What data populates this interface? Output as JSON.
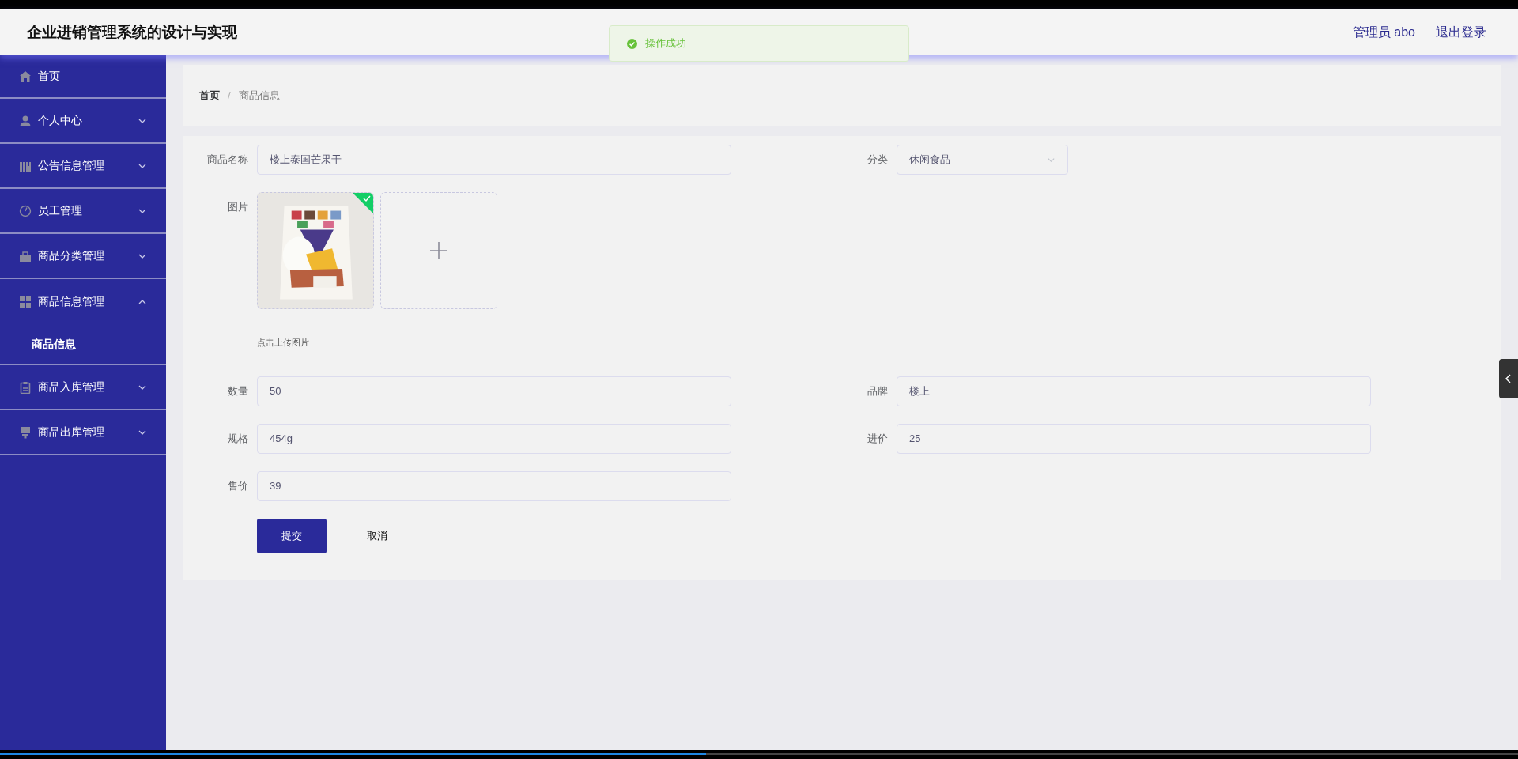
{
  "header": {
    "title": "企业进销管理系统的设计与实现",
    "user": "管理员 abo",
    "logout": "退出登录"
  },
  "toast": {
    "kind": "success",
    "message": "操作成功"
  },
  "sidebar": {
    "items": [
      {
        "label": "首页",
        "kind": "link"
      },
      {
        "label": "个人中心",
        "kind": "menu",
        "expanded": false
      },
      {
        "label": "公告信息管理",
        "kind": "menu",
        "expanded": false
      },
      {
        "label": "员工管理",
        "kind": "menu",
        "expanded": false
      },
      {
        "label": "商品分类管理",
        "kind": "menu",
        "expanded": false
      },
      {
        "label": "商品信息管理",
        "kind": "menu",
        "expanded": true,
        "children": [
          {
            "label": "商品信息"
          }
        ]
      },
      {
        "label": "商品入库管理",
        "kind": "menu",
        "expanded": false
      },
      {
        "label": "商品出库管理",
        "kind": "menu",
        "expanded": false
      }
    ]
  },
  "breadcrumb": {
    "separator": "/",
    "items": [
      "首页",
      "商品信息"
    ]
  },
  "form": {
    "rows": [
      [
        {
          "label": "商品名称",
          "kind": "text",
          "value": "楼上泰国芒果干"
        },
        {
          "label": "分类",
          "kind": "select",
          "value": "休闲食品"
        }
      ],
      [
        {
          "label": "图片",
          "kind": "upload",
          "uploaded": true,
          "hint": "点击上传图片"
        }
      ],
      [
        {
          "label": "数量",
          "kind": "text",
          "value": "50"
        },
        {
          "label": "品牌",
          "kind": "text",
          "value": "楼上"
        }
      ],
      [
        {
          "label": "规格",
          "kind": "text",
          "value": "454g"
        },
        {
          "label": "进价",
          "kind": "text",
          "value": "25"
        }
      ],
      [
        {
          "label": "售价",
          "kind": "text",
          "value": "39"
        }
      ]
    ],
    "buttons": [
      {
        "label": "提交",
        "kind": "primary"
      },
      {
        "label": "取消",
        "kind": "plain"
      }
    ]
  },
  "player": {
    "level": 0.465
  }
}
